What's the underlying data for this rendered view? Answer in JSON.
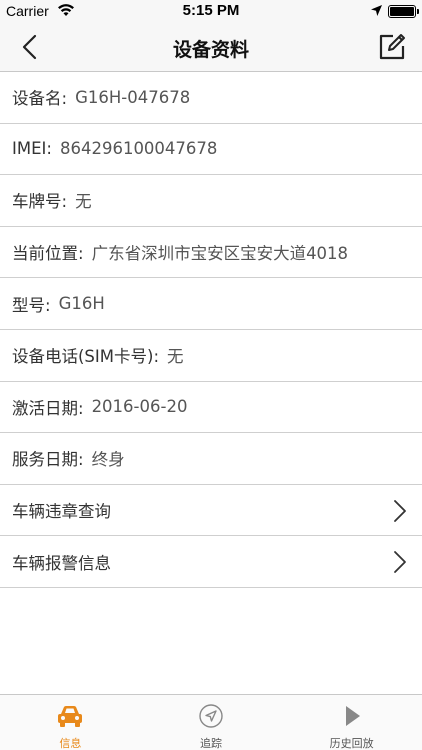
{
  "status_bar": {
    "carrier": "Carrier",
    "time": "5:15 PM"
  },
  "nav": {
    "title": "设备资料"
  },
  "rows": [
    {
      "label": "设备名:",
      "value": "G16H-047678"
    },
    {
      "label": "IMEI:",
      "value": "864296100047678"
    },
    {
      "label": "车牌号:",
      "value": "无"
    },
    {
      "label": "当前位置:",
      "value": "广东省深圳市宝安区宝安大道4018"
    },
    {
      "label": "型号:",
      "value": "G16H"
    },
    {
      "label": "设备电话(SIM卡号):",
      "value": "无"
    },
    {
      "label": "激活日期:",
      "value": "2016-06-20"
    },
    {
      "label": "服务日期:",
      "value": "终身"
    }
  ],
  "links": [
    {
      "label": "车辆违章查询"
    },
    {
      "label": "车辆报警信息"
    }
  ],
  "tabs": [
    {
      "label": "信息",
      "icon": "car-icon",
      "active": true
    },
    {
      "label": "追踪",
      "icon": "navigation-icon",
      "active": false
    },
    {
      "label": "历史回放",
      "icon": "play-icon",
      "active": false
    }
  ],
  "colors": {
    "accent": "#e8891a",
    "inactive_icon": "#888888"
  }
}
